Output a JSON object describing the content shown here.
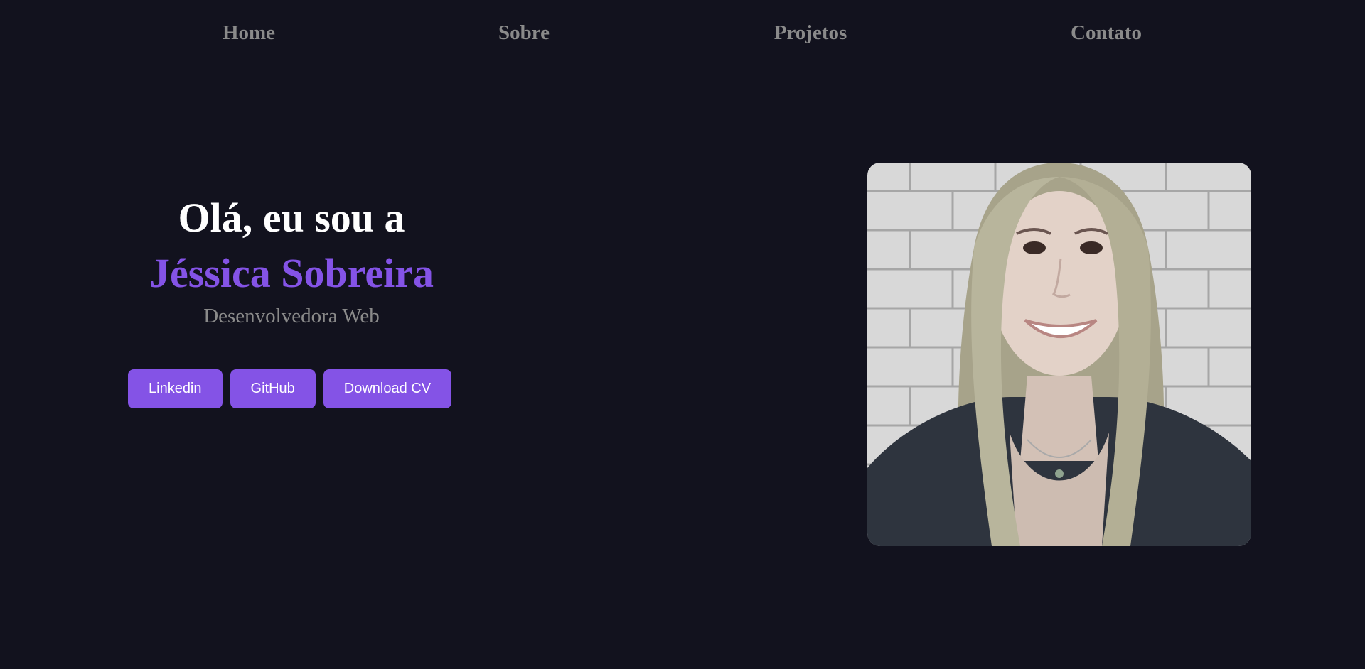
{
  "nav": {
    "items": [
      {
        "label": "Home"
      },
      {
        "label": "Sobre"
      },
      {
        "label": "Projetos"
      },
      {
        "label": "Contato"
      }
    ]
  },
  "hero": {
    "greeting": "Olá, eu sou a",
    "name": "Jéssica Sobreira",
    "role": "Desenvolvedora Web",
    "buttons": [
      {
        "label": "Linkedin"
      },
      {
        "label": "GitHub"
      },
      {
        "label": "Download CV"
      }
    ]
  },
  "colors": {
    "background": "#12121e",
    "accent": "#8453e6",
    "muted_text": "#8a8a8a",
    "heading": "#ffffff"
  }
}
